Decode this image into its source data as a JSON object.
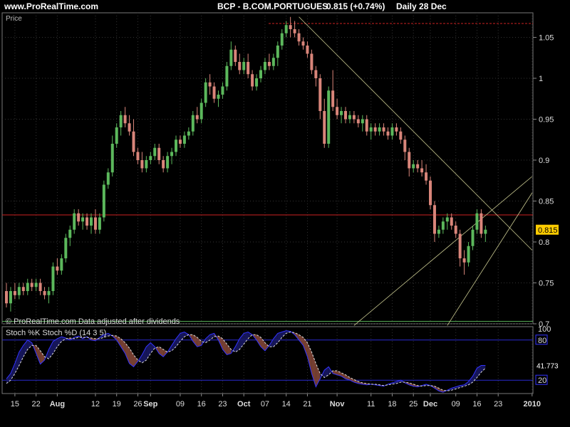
{
  "header": {
    "site": "www.ProRealTime.com",
    "symbol": "BCP - B.COM.PORTUGUES",
    "price": "0.815 (+0.74%)",
    "period": "Daily  28 Dec"
  },
  "colors": {
    "up": "#5cb85c",
    "down": "#d9857a",
    "grid": "#333333",
    "panel_border": "#777777",
    "h_line_red": "#cc2222",
    "h_line_green": "#55aa55",
    "trendline": "#c8c890",
    "stoch_k": "#3333ff",
    "stoch_d": "#dddddd",
    "stoch_fill": "#8a4a3a",
    "price_tag": "#ffcc00"
  },
  "chart_data": [
    {
      "type": "candlestick",
      "panel_label": "Price",
      "source_note": "© ProRealTime.com  Data adjusted after dividends",
      "last_price_label": "0.815",
      "ylim": [
        0.7,
        1.08
      ],
      "y_ticks": [
        0.7,
        0.75,
        0.8,
        0.85,
        0.9,
        0.95,
        1,
        1.05
      ],
      "x_ticks": [
        {
          "label": "15",
          "idx": 2
        },
        {
          "label": "22",
          "idx": 7
        },
        {
          "label": "Aug",
          "idx": 12,
          "bold": true
        },
        {
          "label": "12",
          "idx": 21
        },
        {
          "label": "19",
          "idx": 26
        },
        {
          "label": "26",
          "idx": 31
        },
        {
          "label": "Sep",
          "idx": 34,
          "bold": true
        },
        {
          "label": "09",
          "idx": 41
        },
        {
          "label": "16",
          "idx": 46
        },
        {
          "label": "23",
          "idx": 51
        },
        {
          "label": "Oct",
          "idx": 56,
          "bold": true
        },
        {
          "label": "07",
          "idx": 61
        },
        {
          "label": "14",
          "idx": 66
        },
        {
          "label": "21",
          "idx": 71
        },
        {
          "label": "Nov",
          "idx": 78,
          "bold": true
        },
        {
          "label": "11",
          "idx": 86
        },
        {
          "label": "18",
          "idx": 91
        },
        {
          "label": "25",
          "idx": 96
        },
        {
          "label": "Dec",
          "idx": 100,
          "bold": true
        },
        {
          "label": "09",
          "idx": 106
        },
        {
          "label": "16",
          "idx": 111
        },
        {
          "label": "23",
          "idx": 116
        },
        {
          "label": "2010",
          "idx": 124,
          "bold": true
        }
      ],
      "h_lines": [
        {
          "value": 0.833,
          "role": "red"
        },
        {
          "value": 1.067,
          "role": "red-dashed"
        },
        {
          "value": 0.703,
          "role": "green"
        }
      ],
      "candles": [
        [
          0.74,
          0.75,
          0.72,
          0.725
        ],
        [
          0.725,
          0.745,
          0.715,
          0.74
        ],
        [
          0.74,
          0.75,
          0.73,
          0.735
        ],
        [
          0.735,
          0.75,
          0.73,
          0.745
        ],
        [
          0.745,
          0.75,
          0.735,
          0.74
        ],
        [
          0.74,
          0.755,
          0.735,
          0.75
        ],
        [
          0.75,
          0.755,
          0.74,
          0.745
        ],
        [
          0.745,
          0.755,
          0.74,
          0.75
        ],
        [
          0.75,
          0.755,
          0.735,
          0.74
        ],
        [
          0.74,
          0.745,
          0.73,
          0.735
        ],
        [
          0.735,
          0.745,
          0.725,
          0.74
        ],
        [
          0.74,
          0.775,
          0.735,
          0.77
        ],
        [
          0.77,
          0.78,
          0.76,
          0.765
        ],
        [
          0.765,
          0.785,
          0.76,
          0.78
        ],
        [
          0.78,
          0.81,
          0.775,
          0.805
        ],
        [
          0.805,
          0.82,
          0.795,
          0.815
        ],
        [
          0.815,
          0.84,
          0.81,
          0.835
        ],
        [
          0.835,
          0.84,
          0.82,
          0.825
        ],
        [
          0.825,
          0.835,
          0.815,
          0.83
        ],
        [
          0.83,
          0.835,
          0.815,
          0.82
        ],
        [
          0.82,
          0.835,
          0.81,
          0.83
        ],
        [
          0.83,
          0.84,
          0.81,
          0.815
        ],
        [
          0.815,
          0.835,
          0.81,
          0.83
        ],
        [
          0.83,
          0.875,
          0.825,
          0.87
        ],
        [
          0.87,
          0.89,
          0.865,
          0.885
        ],
        [
          0.885,
          0.93,
          0.88,
          0.92
        ],
        [
          0.92,
          0.945,
          0.915,
          0.94
        ],
        [
          0.94,
          0.96,
          0.93,
          0.955
        ],
        [
          0.955,
          0.965,
          0.94,
          0.945
        ],
        [
          0.945,
          0.955,
          0.93,
          0.935
        ],
        [
          0.935,
          0.95,
          0.905,
          0.91
        ],
        [
          0.91,
          0.915,
          0.895,
          0.9
        ],
        [
          0.9,
          0.91,
          0.885,
          0.89
        ],
        [
          0.89,
          0.905,
          0.885,
          0.9
        ],
        [
          0.9,
          0.91,
          0.895,
          0.905
        ],
        [
          0.905,
          0.92,
          0.9,
          0.915
        ],
        [
          0.915,
          0.92,
          0.895,
          0.9
        ],
        [
          0.9,
          0.905,
          0.885,
          0.89
        ],
        [
          0.89,
          0.91,
          0.885,
          0.905
        ],
        [
          0.905,
          0.915,
          0.895,
          0.91
        ],
        [
          0.91,
          0.93,
          0.905,
          0.925
        ],
        [
          0.925,
          0.93,
          0.915,
          0.92
        ],
        [
          0.92,
          0.935,
          0.915,
          0.93
        ],
        [
          0.93,
          0.94,
          0.925,
          0.935
        ],
        [
          0.935,
          0.96,
          0.93,
          0.955
        ],
        [
          0.955,
          0.965,
          0.945,
          0.95
        ],
        [
          0.95,
          0.975,
          0.945,
          0.97
        ],
        [
          0.97,
          1.0,
          0.965,
          0.995
        ],
        [
          0.995,
          1.005,
          0.98,
          0.99
        ],
        [
          0.99,
          0.995,
          0.97,
          0.975
        ],
        [
          0.975,
          0.985,
          0.965,
          0.98
        ],
        [
          0.98,
          0.995,
          0.975,
          0.99
        ],
        [
          0.99,
          1.02,
          0.985,
          1.015
        ],
        [
          1.015,
          1.045,
          1.01,
          1.035
        ],
        [
          1.035,
          1.04,
          1.015,
          1.02
        ],
        [
          1.02,
          1.03,
          1.005,
          1.01
        ],
        [
          1.01,
          1.025,
          1.005,
          1.02
        ],
        [
          1.02,
          1.03,
          1.0,
          1.005
        ],
        [
          1.005,
          1.01,
          0.985,
          0.99
        ],
        [
          0.99,
          1.005,
          0.985,
          1.0
        ],
        [
          1.0,
          1.015,
          0.995,
          1.01
        ],
        [
          1.01,
          1.025,
          1.005,
          1.02
        ],
        [
          1.02,
          1.03,
          1.01,
          1.015
        ],
        [
          1.015,
          1.03,
          1.01,
          1.025
        ],
        [
          1.025,
          1.045,
          1.015,
          1.04
        ],
        [
          1.04,
          1.06,
          1.035,
          1.055
        ],
        [
          1.055,
          1.07,
          1.05,
          1.065
        ],
        [
          1.065,
          1.075,
          1.05,
          1.06
        ],
        [
          1.06,
          1.07,
          1.05,
          1.055
        ],
        [
          1.055,
          1.06,
          1.04,
          1.045
        ],
        [
          1.045,
          1.05,
          1.035,
          1.04
        ],
        [
          1.04,
          1.045,
          1.025,
          1.03
        ],
        [
          1.03,
          1.035,
          1.005,
          1.01
        ],
        [
          1.01,
          1.015,
          0.99,
          1.0
        ],
        [
          1.0,
          1.005,
          0.95,
          0.96
        ],
        [
          0.96,
          0.975,
          0.915,
          0.92
        ],
        [
          0.92,
          0.99,
          0.915,
          0.985
        ],
        [
          0.985,
          1.01,
          0.96,
          0.965
        ],
        [
          0.965,
          0.975,
          0.95,
          0.955
        ],
        [
          0.955,
          0.965,
          0.945,
          0.96
        ],
        [
          0.96,
          0.965,
          0.945,
          0.95
        ],
        [
          0.95,
          0.96,
          0.945,
          0.955
        ],
        [
          0.955,
          0.96,
          0.945,
          0.95
        ],
        [
          0.95,
          0.955,
          0.94,
          0.945
        ],
        [
          0.945,
          0.955,
          0.935,
          0.95
        ],
        [
          0.95,
          0.955,
          0.93,
          0.935
        ],
        [
          0.935,
          0.945,
          0.925,
          0.94
        ],
        [
          0.94,
          0.945,
          0.93,
          0.935
        ],
        [
          0.935,
          0.945,
          0.93,
          0.94
        ],
        [
          0.94,
          0.945,
          0.93,
          0.935
        ],
        [
          0.935,
          0.94,
          0.925,
          0.93
        ],
        [
          0.93,
          0.945,
          0.925,
          0.94
        ],
        [
          0.94,
          0.945,
          0.93,
          0.935
        ],
        [
          0.935,
          0.94,
          0.92,
          0.925
        ],
        [
          0.925,
          0.93,
          0.9,
          0.91
        ],
        [
          0.91,
          0.915,
          0.88,
          0.89
        ],
        [
          0.89,
          0.9,
          0.885,
          0.895
        ],
        [
          0.895,
          0.9,
          0.885,
          0.89
        ],
        [
          0.89,
          0.9,
          0.88,
          0.885
        ],
        [
          0.885,
          0.895,
          0.87,
          0.875
        ],
        [
          0.875,
          0.88,
          0.84,
          0.845
        ],
        [
          0.845,
          0.85,
          0.8,
          0.81
        ],
        [
          0.81,
          0.82,
          0.805,
          0.815
        ],
        [
          0.815,
          0.83,
          0.81,
          0.825
        ],
        [
          0.825,
          0.835,
          0.815,
          0.83
        ],
        [
          0.83,
          0.835,
          0.815,
          0.82
        ],
        [
          0.82,
          0.825,
          0.805,
          0.81
        ],
        [
          0.81,
          0.815,
          0.77,
          0.78
        ],
        [
          0.78,
          0.79,
          0.76,
          0.775
        ],
        [
          0.775,
          0.8,
          0.77,
          0.795
        ],
        [
          0.795,
          0.82,
          0.79,
          0.815
        ],
        [
          0.815,
          0.84,
          0.81,
          0.835
        ],
        [
          0.835,
          0.84,
          0.805,
          0.81
        ],
        [
          0.81,
          0.82,
          0.8,
          0.815
        ]
      ],
      "trendlines": [
        {
          "from": [
            69,
            1.075
          ],
          "to": [
            124,
            0.79
          ]
        },
        {
          "from": [
            82,
            0.698
          ],
          "to": [
            124,
            0.88
          ]
        },
        {
          "from": [
            104,
            0.698
          ],
          "to": [
            124,
            0.86
          ]
        }
      ]
    },
    {
      "type": "line",
      "panel_label": "Stoch %K Stoch %D (14 3 5)",
      "ylim": [
        0,
        100
      ],
      "y_ticks": [
        {
          "label": "100",
          "value": 97
        },
        {
          "label": "80",
          "value": 80,
          "boxed": true
        },
        {
          "label": "20",
          "value": 20,
          "boxed": true
        }
      ],
      "h_lines": [
        80,
        20
      ],
      "last_value_label": "41.773",
      "series": [
        {
          "role": "k",
          "values": [
            22,
            30,
            45,
            62,
            72,
            80,
            76,
            60,
            44,
            50,
            66,
            78,
            82,
            85,
            83,
            80,
            84,
            86,
            82,
            85,
            80,
            79,
            84,
            88,
            90,
            86,
            80,
            70,
            60,
            45,
            40,
            48,
            58,
            70,
            76,
            70,
            60,
            55,
            62,
            72,
            82,
            90,
            92,
            88,
            78,
            70,
            72,
            82,
            88,
            90,
            80,
            66,
            58,
            60,
            70,
            82,
            90,
            92,
            88,
            80,
            70,
            64,
            72,
            82,
            90,
            92,
            94,
            93,
            88,
            80,
            72,
            55,
            30,
            10,
            22,
            35,
            40,
            30,
            28,
            26,
            22,
            20,
            17,
            15,
            14,
            13,
            14,
            13,
            12,
            11,
            14,
            16,
            18,
            20,
            16,
            13,
            11,
            10,
            12,
            14,
            12,
            8,
            4,
            2,
            5,
            8,
            10,
            12,
            13,
            18,
            26,
            38,
            42,
            42
          ]
        },
        {
          "role": "d",
          "values": [
            15,
            20,
            30,
            42,
            55,
            66,
            72,
            72,
            64,
            55,
            52,
            60,
            70,
            78,
            82,
            83,
            82,
            84,
            84,
            84,
            83,
            82,
            82,
            84,
            86,
            87,
            86,
            82,
            76,
            68,
            58,
            50,
            46,
            50,
            60,
            68,
            70,
            66,
            62,
            64,
            70,
            78,
            85,
            88,
            88,
            84,
            78,
            76,
            80,
            85,
            86,
            82,
            74,
            66,
            62,
            66,
            74,
            82,
            88,
            88,
            84,
            76,
            70,
            70,
            76,
            84,
            90,
            92,
            91,
            88,
            84,
            76,
            62,
            45,
            30,
            24,
            28,
            34,
            34,
            31,
            28,
            24,
            21,
            18,
            16,
            15,
            14,
            14,
            13,
            12,
            13,
            14,
            15,
            17,
            17,
            16,
            14,
            12,
            11,
            12,
            12,
            11,
            8,
            5,
            4,
            5,
            7,
            9,
            11,
            13,
            17,
            24,
            32,
            38
          ]
        }
      ]
    }
  ]
}
